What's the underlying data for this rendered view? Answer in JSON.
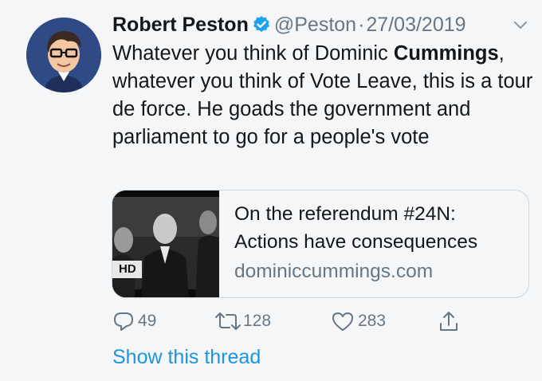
{
  "tweet": {
    "author_name": "Robert Peston",
    "handle": "@Peston",
    "separator": "·",
    "date": "27/03/2019",
    "text_part1": "Whatever you think of Dominic ",
    "text_bold": "Cummings",
    "text_part2": ", whatever you think of Vote Leave, this is a tour de force. He goads the government and parliament to go for a people's vote"
  },
  "card": {
    "thumbnail_badge": "HD",
    "title": "On the referendum #24N: Actions have consequences",
    "domain": "dominiccummings.com"
  },
  "actions": {
    "replies": "49",
    "retweets": "128",
    "likes": "283"
  },
  "show_thread": "Show this thread",
  "icons": {
    "verified": "verified-badge-icon",
    "menu": "chevron-down-icon",
    "reply": "reply-icon",
    "retweet": "retweet-icon",
    "like": "heart-icon",
    "share": "share-icon"
  },
  "colors": {
    "link": "#1b95e0",
    "secondary_text": "#657786",
    "verified": "#1da1f2",
    "avatar_bg": "#2f4a85"
  }
}
